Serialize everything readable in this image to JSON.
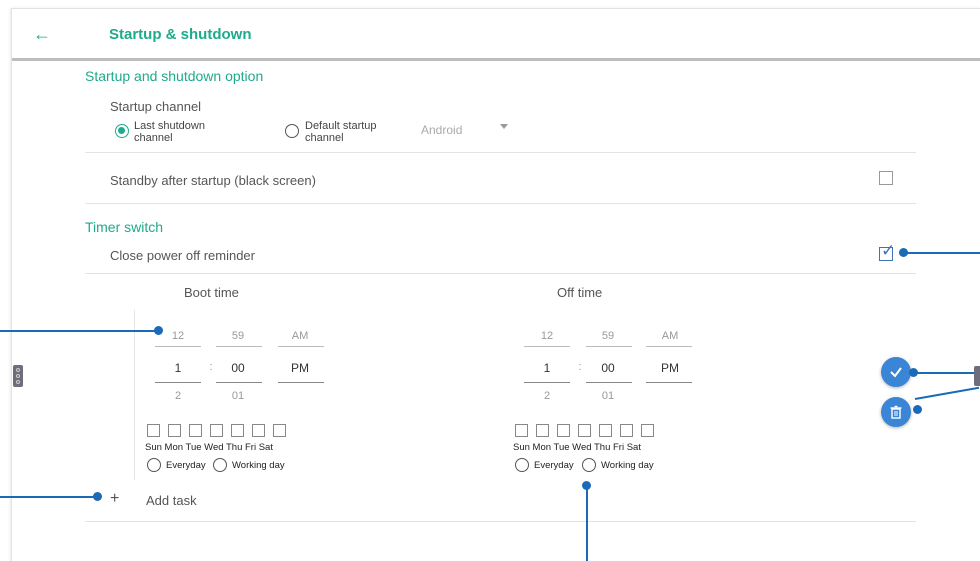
{
  "header": {
    "back_icon": "arrow-left-icon",
    "title": "Startup & shutdown"
  },
  "startup_option": {
    "section_title": "Startup and shutdown option",
    "startup_channel_label": "Startup channel",
    "radio_last_line1": "Last shutdown",
    "radio_last_line2": "channel",
    "radio_default_line1": "Default startup",
    "radio_default_line2": "channel",
    "dropdown_value": "Android",
    "standby_label": "Standby after startup (black screen)"
  },
  "timer": {
    "section_title": "Timer switch",
    "close_reminder_label": "Close power off reminder",
    "boot_time_label": "Boot time",
    "off_time_label": "Off time",
    "boot": {
      "hour_prev": "12",
      "min_prev": "59",
      "ampm_prev": "AM",
      "hour": "1",
      "sep": ":",
      "min": "00",
      "ampm": "PM",
      "hour_next": "2",
      "min_next": "01"
    },
    "off": {
      "hour_prev": "12",
      "min_prev": "59",
      "ampm_prev": "AM",
      "hour": "1",
      "sep": ":",
      "min": "00",
      "ampm": "PM",
      "hour_next": "2",
      "min_next": "01"
    },
    "days_text": "Sun Mon Tue Wed Thu Fri  Sat",
    "everyday_label": "Everyday",
    "working_day_label": "Working day",
    "add_task_icon": "+",
    "add_task_label": "Add task"
  },
  "actions": {
    "confirm_icon": "check-icon",
    "delete_icon": "trash-icon"
  },
  "colors": {
    "accent": "#1eaa8c",
    "button_blue": "#3b85d6",
    "callout": "#1a6ab8"
  }
}
